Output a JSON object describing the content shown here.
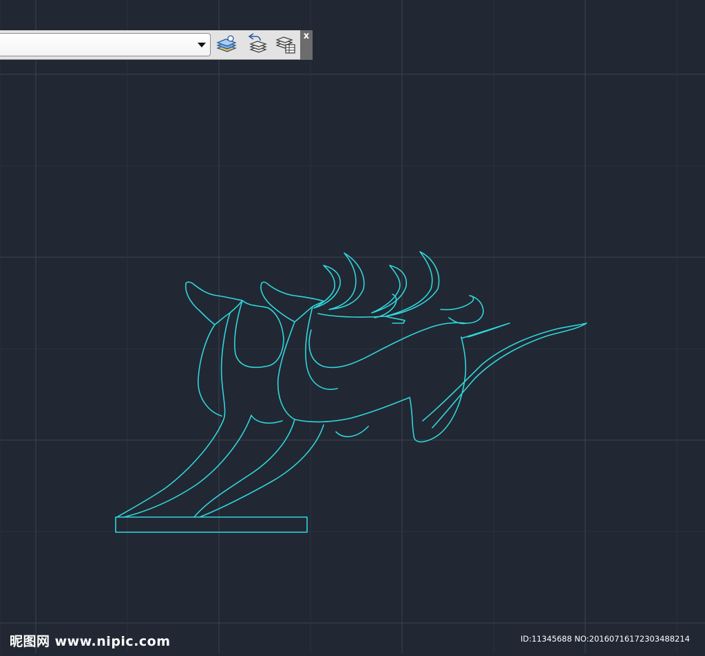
{
  "toolbar": {
    "layer_value": "",
    "icons": [
      "layer-properties-icon",
      "layer-previous-icon",
      "layer-states-icon"
    ],
    "close_label": "x"
  },
  "canvas": {
    "background": "#212833",
    "grid_color": "#3a4350",
    "drawing_color": "#31d6dc",
    "drawing_subject": "leaping-deer-sculpture"
  },
  "watermark": {
    "site": "昵图网 www.nipic.com",
    "id": "ID:11345688 NO:20160716172303488214"
  }
}
